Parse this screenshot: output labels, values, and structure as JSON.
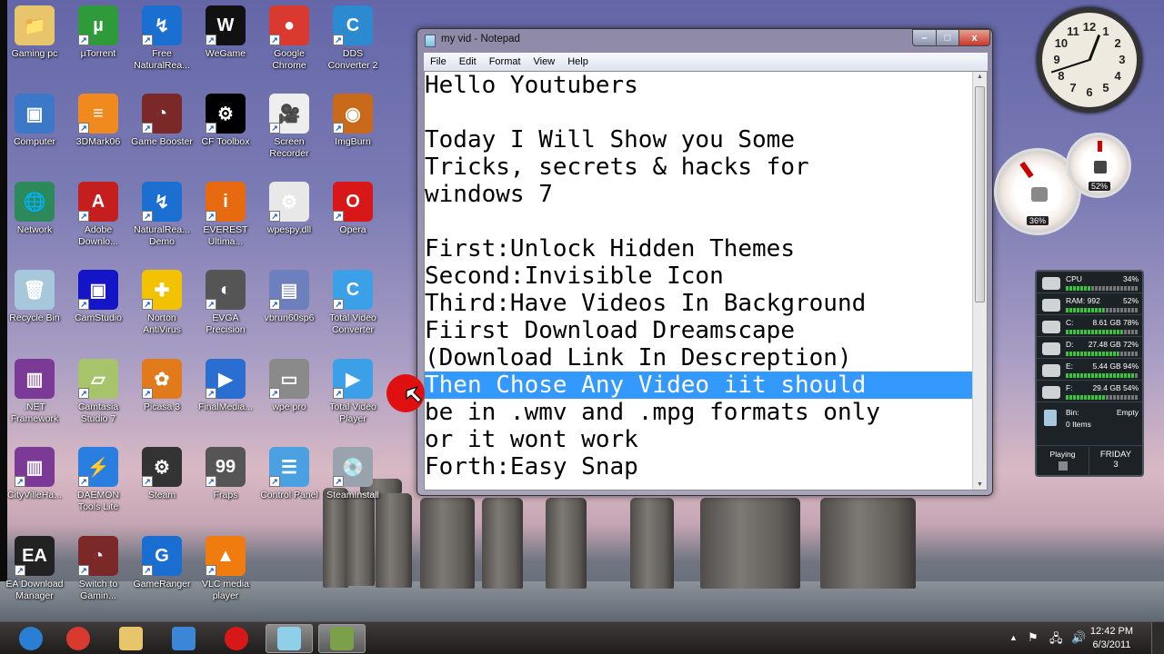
{
  "desktop": {
    "icons": [
      {
        "label": "Gaming pc",
        "color": "#e8c46a",
        "glyph": "📁"
      },
      {
        "label": "µTorrent",
        "color": "#2f9a3a",
        "glyph": "µ"
      },
      {
        "label": "Free NaturalRea...",
        "color": "#1b6fd1",
        "glyph": "↯"
      },
      {
        "label": "WeGame",
        "color": "#111111",
        "glyph": "W"
      },
      {
        "label": "Google Chrome",
        "color": "#d9392e",
        "glyph": "●"
      },
      {
        "label": "DDS Converter 2",
        "color": "#2c8ad1",
        "glyph": "C"
      },
      {
        "label": "Computer",
        "color": "#3c78c8",
        "glyph": "▣"
      },
      {
        "label": "3DMark06",
        "color": "#f08a1e",
        "glyph": "≡"
      },
      {
        "label": "Game Booster",
        "color": "#7a2828",
        "glyph": "◔"
      },
      {
        "label": "CF Toolbox",
        "color": "#000000",
        "glyph": "⚙"
      },
      {
        "label": "Screen Recorder",
        "color": "#eeeeee",
        "glyph": "🎥"
      },
      {
        "label": "ImgBurn",
        "color": "#c86a1a",
        "glyph": "◉"
      },
      {
        "label": "Network",
        "color": "#2c8a5a",
        "glyph": "🌐"
      },
      {
        "label": "Adobe Downlo...",
        "color": "#c41e1e",
        "glyph": "A"
      },
      {
        "label": "NaturalRea... Demo",
        "color": "#1b6fd1",
        "glyph": "↯"
      },
      {
        "label": "EVEREST Ultima...",
        "color": "#e86a10",
        "glyph": "i"
      },
      {
        "label": "wpespy.dll",
        "color": "#e8e8e8",
        "glyph": "⚙"
      },
      {
        "label": "Opera",
        "color": "#d81818",
        "glyph": "O"
      },
      {
        "label": "Recycle Bin",
        "color": "#a7c7dd",
        "glyph": "🗑"
      },
      {
        "label": "CamStudio",
        "color": "#1515c8",
        "glyph": "▣"
      },
      {
        "label": "Norton AntiVirus",
        "color": "#f2c200",
        "glyph": "✚"
      },
      {
        "label": "EVGA Precision",
        "color": "#555555",
        "glyph": "◐"
      },
      {
        "label": "vbrun60sp6",
        "color": "#6d7fbd",
        "glyph": "▤"
      },
      {
        "label": "Total Video Converter",
        "color": "#3ba0e8",
        "glyph": "C"
      },
      {
        "label": ".NET Framework",
        "color": "#7b3a96",
        "glyph": "▥"
      },
      {
        "label": "Camtasia Studio 7",
        "color": "#a7c46a",
        "glyph": "▱"
      },
      {
        "label": "Picasa 3",
        "color": "#e07a1a",
        "glyph": "✿"
      },
      {
        "label": "FinalMedia...",
        "color": "#2a6ed1",
        "glyph": "▶"
      },
      {
        "label": "wpe pro",
        "color": "#8a8a8a",
        "glyph": "▭"
      },
      {
        "label": "Total Video Player",
        "color": "#3ba0e8",
        "glyph": "▶"
      },
      {
        "label": "CityVilleHa...",
        "color": "#7b3a96",
        "glyph": "▥"
      },
      {
        "label": "DAEMON Tools Lite",
        "color": "#2a7ee0",
        "glyph": "⚡"
      },
      {
        "label": "Steam",
        "color": "#333333",
        "glyph": "⚙"
      },
      {
        "label": "Fraps",
        "color": "#555555",
        "glyph": "99"
      },
      {
        "label": "Control Panel",
        "color": "#4aa0e0",
        "glyph": "☰"
      },
      {
        "label": "SteamInstall",
        "color": "#9aa3ad",
        "glyph": "💿"
      },
      {
        "label": "EA Download Manager",
        "color": "#222222",
        "glyph": "EA"
      },
      {
        "label": "Switch to Gamin...",
        "color": "#7a2828",
        "glyph": "◔"
      },
      {
        "label": "GameRanger",
        "color": "#1a6ed1",
        "glyph": "G"
      },
      {
        "label": "VLC media player",
        "color": "#f07c10",
        "glyph": "▲"
      }
    ]
  },
  "notepad": {
    "title": "my vid - Notepad",
    "menu": [
      "File",
      "Edit",
      "Format",
      "View",
      "Help"
    ],
    "buttons": {
      "minimize": "–",
      "maximize": "□",
      "close": "x"
    },
    "lines": [
      "Hello Youtubers",
      "",
      "Today I Will Show you Some",
      "Tricks, secrets & hacks for",
      "windows 7",
      "",
      "First:Unlock Hidden Themes",
      "Second:Invisible Icon",
      "Third:Have Videos In Background",
      "Fiirst Download Dreamscape",
      "(Download Link In Descreption)",
      "Then Chose Any Video iit should",
      "be in .wmv and .mpg formats only",
      "or it wont work",
      "Forth:Easy Snap"
    ],
    "selected_line_index": 11
  },
  "gadgets": {
    "clock": {
      "time": "12:42",
      "numbers": [
        "12",
        "1",
        "2",
        "3",
        "4",
        "5",
        "6",
        "7",
        "8",
        "9",
        "10",
        "11"
      ]
    },
    "cpu_gauge": {
      "value": "36%"
    },
    "ram_gauge": {
      "value": "52%"
    },
    "monitor": {
      "rows": [
        {
          "label": "CPU",
          "value": "34%",
          "fill": 0.34
        },
        {
          "label": "RAM: 992",
          "value": "52%",
          "fill": 0.52
        },
        {
          "label": "C:",
          "value": "8.61 GB 78%",
          "fill": 0.78
        },
        {
          "label": "D:",
          "value": "27.48 GB 72%",
          "fill": 0.72
        },
        {
          "label": "E:",
          "value": "5.44 GB 94%",
          "fill": 0.94
        },
        {
          "label": "F:",
          "value": "29.4 GB 54%",
          "fill": 0.54
        }
      ],
      "bin_label": "Bin:",
      "bin_status": "Empty",
      "bin_items": "0 Items",
      "playing_label": "Playing",
      "day": "FRIDAY",
      "date": "3"
    }
  },
  "taskbar": {
    "items": [
      {
        "name": "start",
        "color": "#2a7fd4"
      },
      {
        "name": "chrome",
        "color": "#d9392e"
      },
      {
        "name": "explorer",
        "color": "#e8c46a"
      },
      {
        "name": "media-player",
        "color": "#3b86d6"
      },
      {
        "name": "opera",
        "color": "#d81818"
      },
      {
        "name": "notepad",
        "color": "#8fd0e8"
      },
      {
        "name": "screen-recorder",
        "color": "#7ca04a"
      }
    ],
    "time": "12:42 PM",
    "date": "6/3/2011"
  }
}
